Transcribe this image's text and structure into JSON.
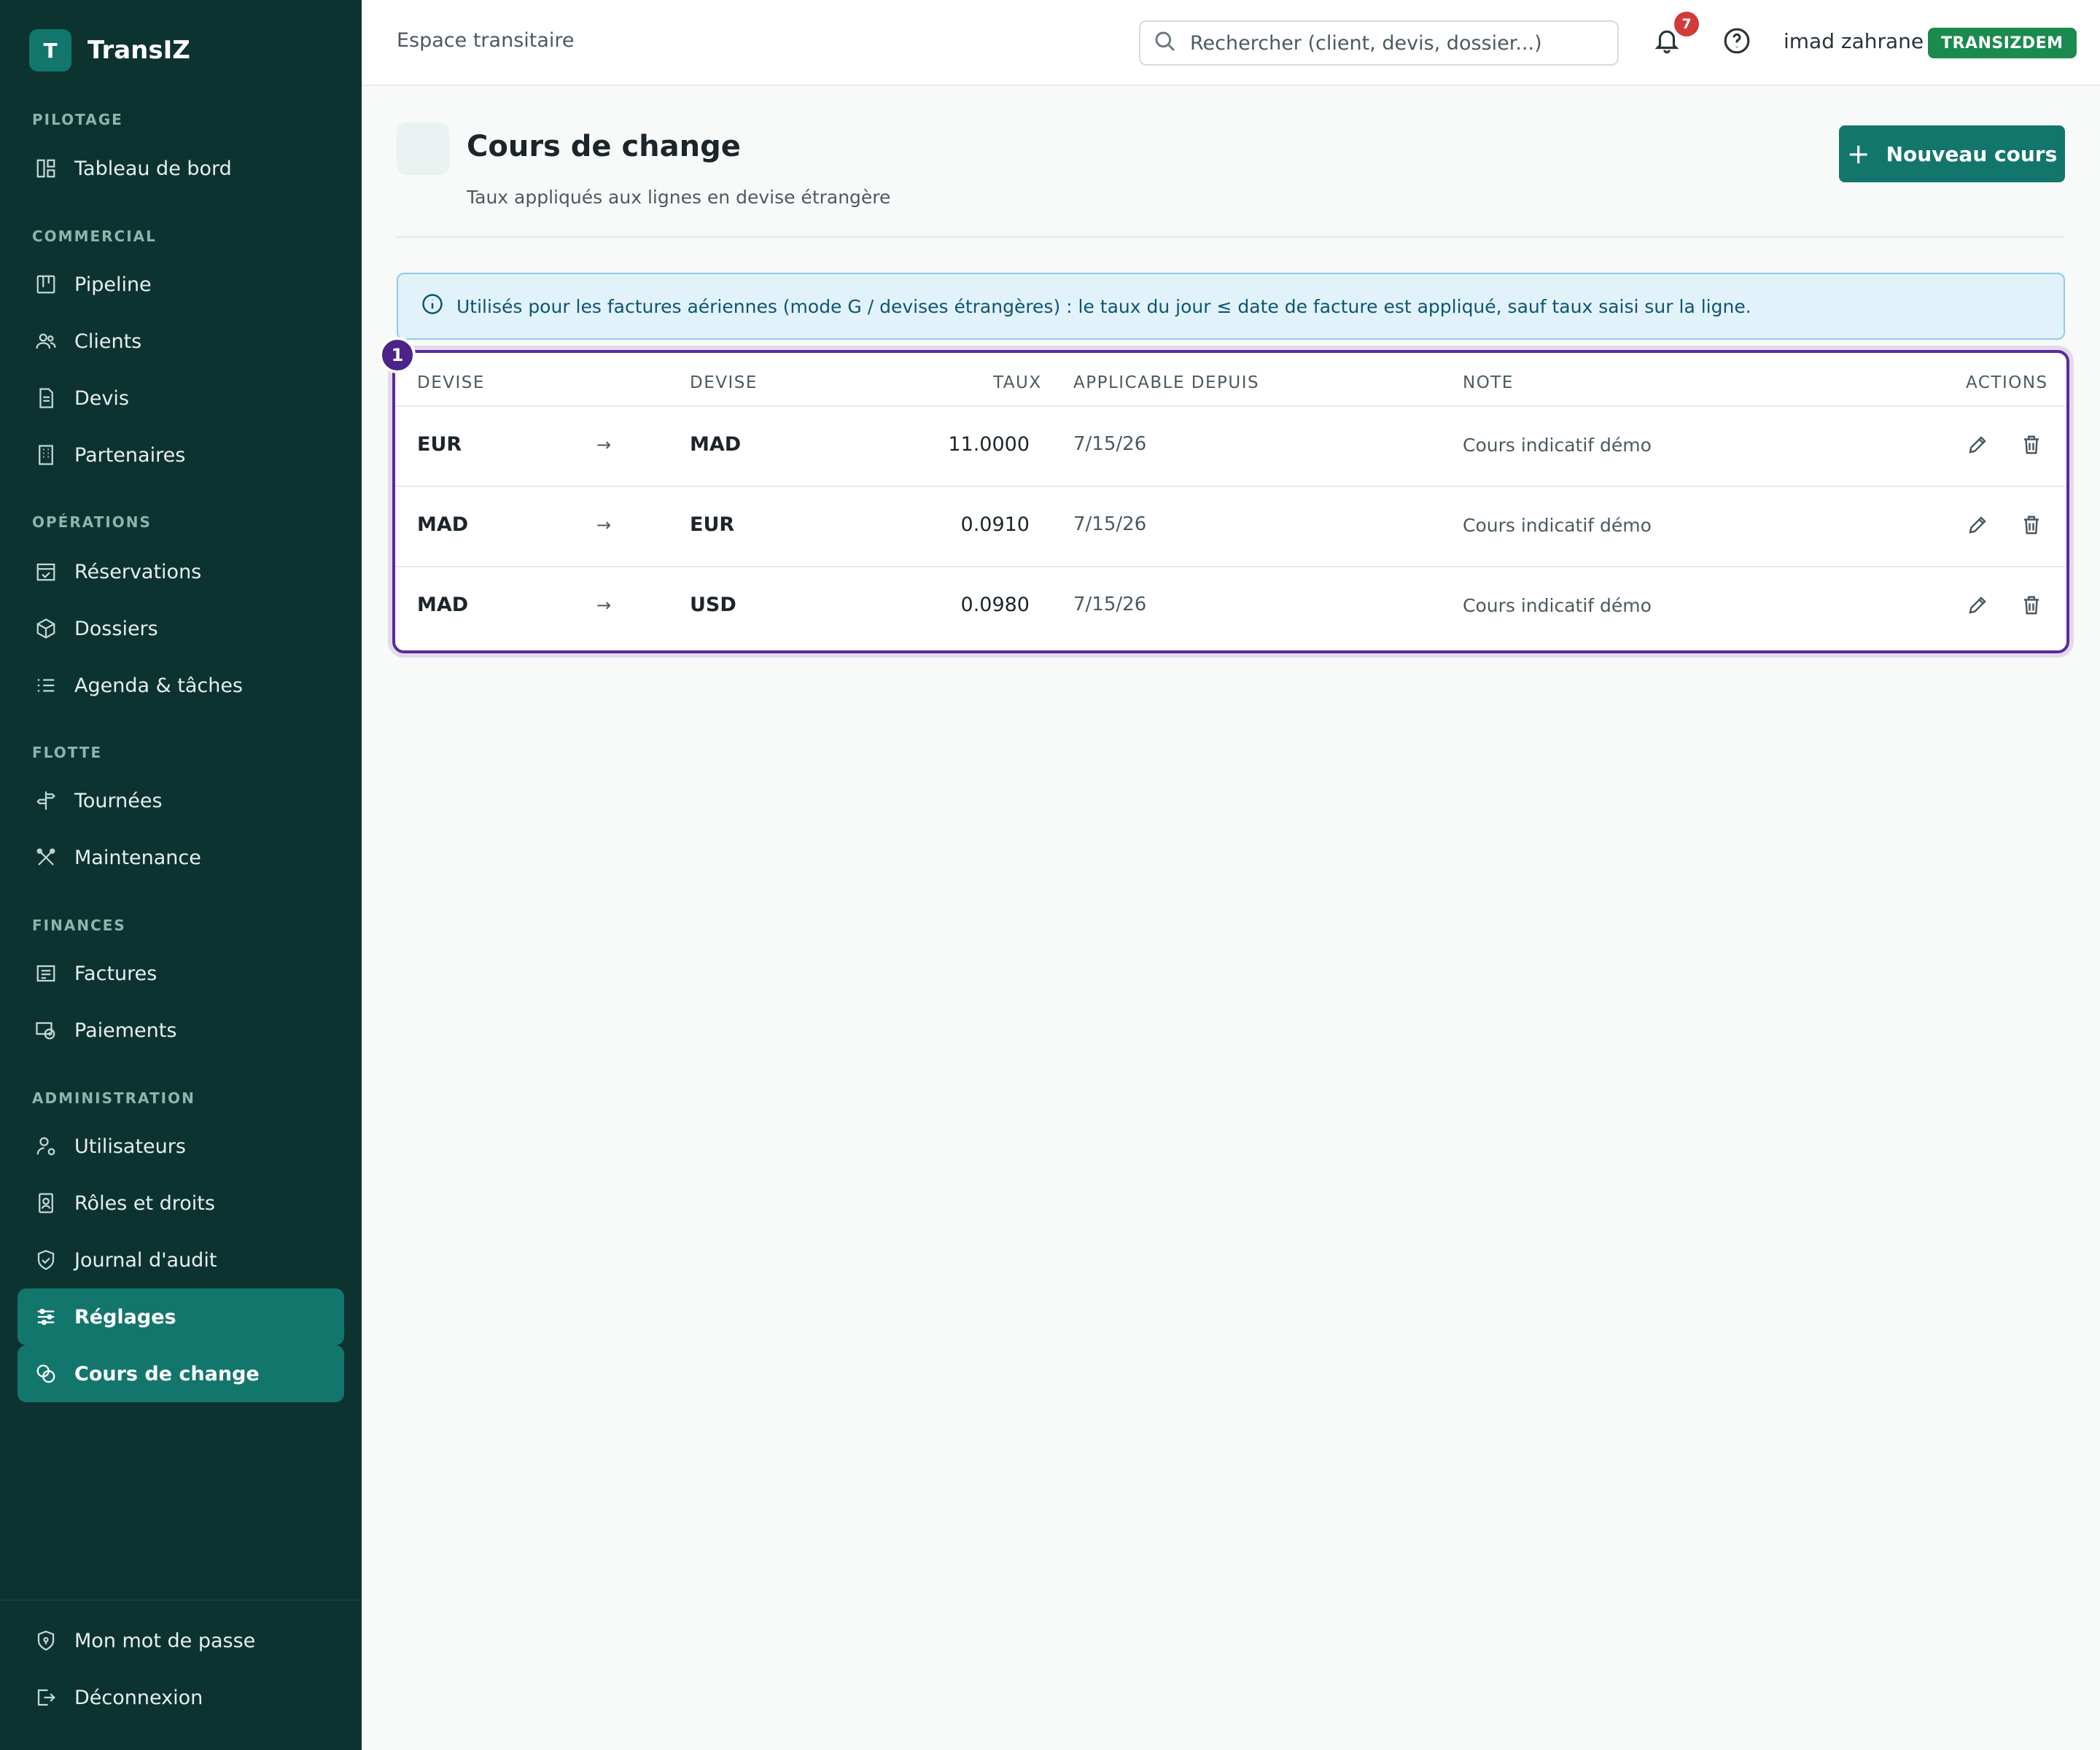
{
  "app": {
    "logo_letter": "T",
    "name": "TransIZ"
  },
  "sidebar": {
    "sections": {
      "pilotage": "PILOTAGE",
      "commercial": "COMMERCIAL",
      "operations": "OPÉRATIONS",
      "flotte": "FLOTTE",
      "finances": "FINANCES",
      "administration": "ADMINISTRATION"
    },
    "items": {
      "tableau": "Tableau de bord",
      "pipeline": "Pipeline",
      "clients": "Clients",
      "devis": "Devis",
      "partenaires": "Partenaires",
      "reservations": "Réservations",
      "dossiers": "Dossiers",
      "agenda": "Agenda & tâches",
      "tournees": "Tournées",
      "maintenance": "Maintenance",
      "factures": "Factures",
      "paiements": "Paiements",
      "utilisateurs": "Utilisateurs",
      "roles": "Rôles et droits",
      "journal": "Journal d'audit",
      "reglages": "Réglages",
      "cours": "Cours de change"
    },
    "footer": {
      "password": "Mon mot de passe",
      "logout": "Déconnexion"
    }
  },
  "topbar": {
    "title": "Espace transitaire",
    "search_placeholder": "Rechercher (client, devis, dossier...)",
    "notifications_count": "7",
    "username": "imad zahrane",
    "tenant": "TRANSIZDEM"
  },
  "page": {
    "title": "Cours de change",
    "subtitle": "Taux appliqués aux lignes en devise étrangère",
    "new_button": "Nouveau cours",
    "info": "Utilisés pour les factures aériennes (mode G / devises étrangères) : le taux du jour ≤ date de facture est appliqué, sauf taux saisi sur la ligne.",
    "step_badge": "1"
  },
  "table": {
    "headers": {
      "from": "DEVISE",
      "to": "DEVISE",
      "rate": "TAUX",
      "since": "APPLICABLE DEPUIS",
      "note": "NOTE",
      "actions": "ACTIONS"
    },
    "rows": [
      {
        "from": "EUR",
        "arrow": "→",
        "to": "MAD",
        "rate": "11.0000",
        "since": "7/15/26",
        "note": "Cours indicatif démo"
      },
      {
        "from": "MAD",
        "arrow": "→",
        "to": "EUR",
        "rate": "0.0910",
        "since": "7/15/26",
        "note": "Cours indicatif démo"
      },
      {
        "from": "MAD",
        "arrow": "→",
        "to": "USD",
        "rate": "0.0980",
        "since": "7/15/26",
        "note": "Cours indicatif démo"
      }
    ]
  },
  "colors": {
    "sidebar_bg": "#0d3331",
    "accent": "#13766c",
    "highlight_border": "#5b2a9a",
    "tenant_badge": "#1a8a4e",
    "notification_badge": "#d33a3a"
  }
}
